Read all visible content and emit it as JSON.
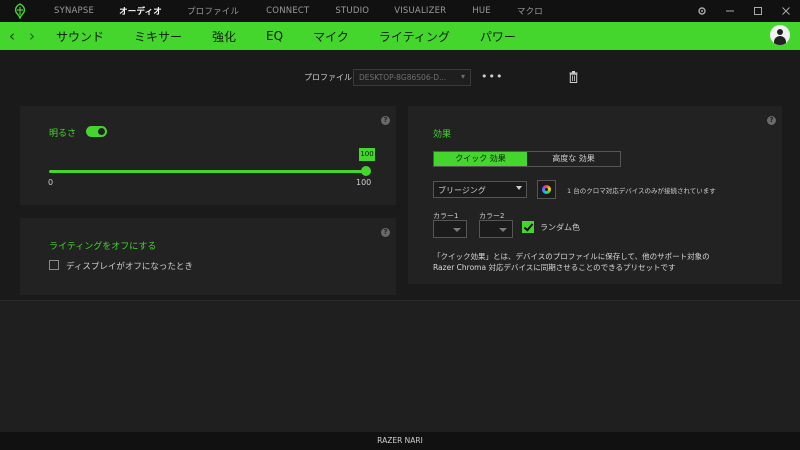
{
  "top_tabs": [
    "SYNAPSE",
    "オーディオ",
    "プロファイル",
    "CONNECT",
    "STUDIO",
    "VISUALIZER",
    "HUE",
    "マクロ"
  ],
  "active_top_tab": "オーディオ",
  "sub_tabs": [
    "サウンド",
    "ミキサー",
    "強化",
    "EQ",
    "マイク",
    "ライティング",
    "パワー"
  ],
  "active_sub_tab": "ライティング",
  "profile": {
    "label": "プロファイル",
    "selected": "DESKTOP-8G86S06-D...",
    "more": "•••"
  },
  "brightness": {
    "label": "明るさ",
    "enabled": true,
    "value": "100",
    "min_label": "0",
    "max_label": "100",
    "level_fraction": 1.0
  },
  "lighting_off": {
    "title": "ライティングをオフにする",
    "checkbox_label": "ディスプレイがオフになったとき",
    "checked": false
  },
  "effect": {
    "title": "効果",
    "tabs": [
      "クイック 効果",
      "高度な 効果"
    ],
    "active_tab": "クイック 効果",
    "selected_effect": "ブリージング",
    "chroma_note": "1 台のクロマ対応デバイスのみが接続されています",
    "color1_label": "カラー1",
    "color2_label": "カラー2",
    "random_label": "ランダム色",
    "random_checked": true,
    "description": "「クイック効果」とは、デバイスのプロファイルに保存して、他のサポート対象の Razer Chroma 対応デバイスに同期させることのできるプリセットです"
  },
  "help_glyph": "?",
  "footer": "RAZER NARI",
  "colors": {
    "accent": "#44d62c",
    "panel": "#222222",
    "background": "#1a1a1a"
  }
}
